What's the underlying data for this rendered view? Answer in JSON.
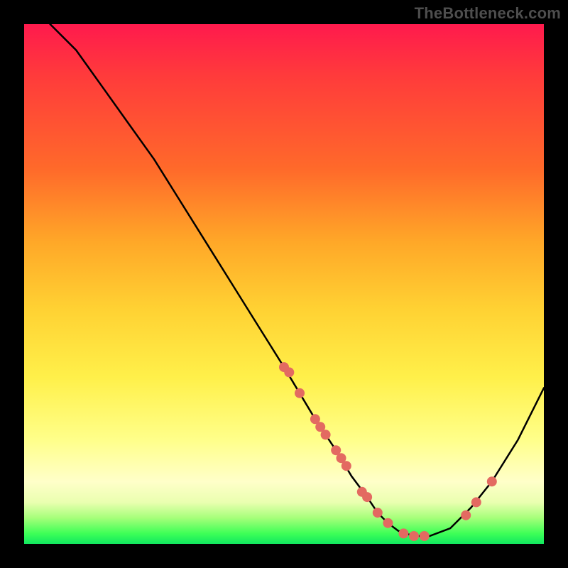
{
  "watermark": "TheBottleneck.com",
  "chart_data": {
    "type": "line",
    "title": "",
    "xlabel": "",
    "ylabel": "",
    "xlim": [
      0,
      100
    ],
    "ylim": [
      0,
      100
    ],
    "curve": {
      "name": "bottleneck-curve",
      "x": [
        5,
        10,
        15,
        20,
        25,
        30,
        35,
        40,
        45,
        50,
        53,
        56,
        60,
        63,
        66,
        68,
        70,
        72,
        75,
        78,
        82,
        86,
        90,
        95,
        100
      ],
      "y": [
        100,
        95,
        88,
        81,
        74,
        66,
        58,
        50,
        42,
        34,
        29,
        24,
        18,
        13,
        9,
        6,
        4,
        2.5,
        1.5,
        1.5,
        3,
        7,
        12,
        20,
        30
      ]
    },
    "points": {
      "name": "sample-points",
      "x": [
        50,
        51,
        53,
        56,
        57,
        58,
        60,
        61,
        62,
        65,
        66,
        68,
        70,
        73,
        75,
        77,
        85,
        87,
        90
      ],
      "y": [
        34,
        33,
        29,
        24,
        22.5,
        21,
        18,
        16.5,
        15,
        10,
        9,
        6,
        4,
        2,
        1.5,
        1.5,
        5.5,
        8,
        12
      ]
    },
    "colors": {
      "curve": "#000000",
      "points": "#e36a61"
    }
  }
}
